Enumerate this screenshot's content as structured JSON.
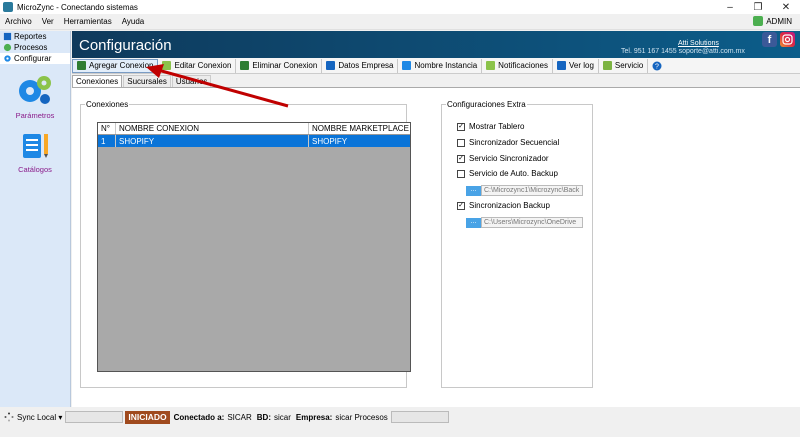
{
  "window": {
    "title": "MicroZync - Conectando sistemas"
  },
  "menu": [
    "Archivo",
    "Ver",
    "Herramientas",
    "Ayuda"
  ],
  "user": {
    "name": "ADMIN"
  },
  "sidebar": {
    "tabs": [
      {
        "label": "Reportes"
      },
      {
        "label": "Procesos"
      },
      {
        "label": "Configurar"
      }
    ],
    "sections": [
      {
        "label": "Parámetros"
      },
      {
        "label": "Catálogos"
      }
    ]
  },
  "header": {
    "title": "Configuración",
    "link": "Atti Solutions",
    "contact": "Tel. 951 167 1455  soporte@atti.com.mx"
  },
  "toolbar": {
    "items": [
      {
        "label": "Agregar Conexion",
        "icon": "save-icon",
        "color": "#2e7d32"
      },
      {
        "label": "Editar Conexion",
        "icon": "pencil-icon",
        "color": "#8bc34a"
      },
      {
        "label": "Eliminar Conexion",
        "icon": "trash-icon",
        "color": "#2e7d32"
      },
      {
        "label": "Datos Empresa",
        "icon": "card-icon",
        "color": "#1565c0"
      },
      {
        "label": "Nombre Instancia",
        "icon": "instance-icon",
        "color": "#1e88e5"
      },
      {
        "label": "Notificaciones",
        "icon": "notification-icon",
        "color": "#8bc34a"
      },
      {
        "label": "Ver log",
        "icon": "log-icon",
        "color": "#1565c0"
      },
      {
        "label": "Servicio",
        "icon": "service-icon",
        "color": "#7cb342"
      }
    ]
  },
  "tabs": [
    "Conexiones",
    "Sucursales",
    "Usuarios"
  ],
  "conexiones": {
    "title": "Conexiones",
    "columns": [
      "N°",
      "NOMBRE CONEXION",
      "NOMBRE MARKETPLACE"
    ],
    "rows": [
      {
        "n": "1",
        "nombre": "SHOPIFY",
        "marketplace": "SHOPIFY"
      }
    ]
  },
  "extra": {
    "title": "Configuraciones Extra",
    "mostrar_tablero": {
      "label": "Mostrar Tablero",
      "checked": true
    },
    "sincronizador_secuencial": {
      "label": "Sincronizador Secuencial",
      "checked": false
    },
    "servicio_sincronizador": {
      "label": "Servicio Sincronizador",
      "checked": true
    },
    "servicio_backup": {
      "label": "Servicio de Auto. Backup",
      "checked": false
    },
    "backup_path": "C:\\Microzync1\\Microzync\\Back",
    "sincronizacion_backup": {
      "label": "Sincronizacion Backup",
      "checked": true
    },
    "onedrive_path": "C:\\Users\\Microzync\\OneDrive"
  },
  "status": {
    "sync": "Sync Local",
    "state": "INICIADO",
    "conectado_label": "Conectado a:",
    "conectado": "SICAR",
    "bd_label": "BD:",
    "bd": "sicar",
    "empresa_label": "Empresa:",
    "empresa": "sicar Procesos"
  }
}
